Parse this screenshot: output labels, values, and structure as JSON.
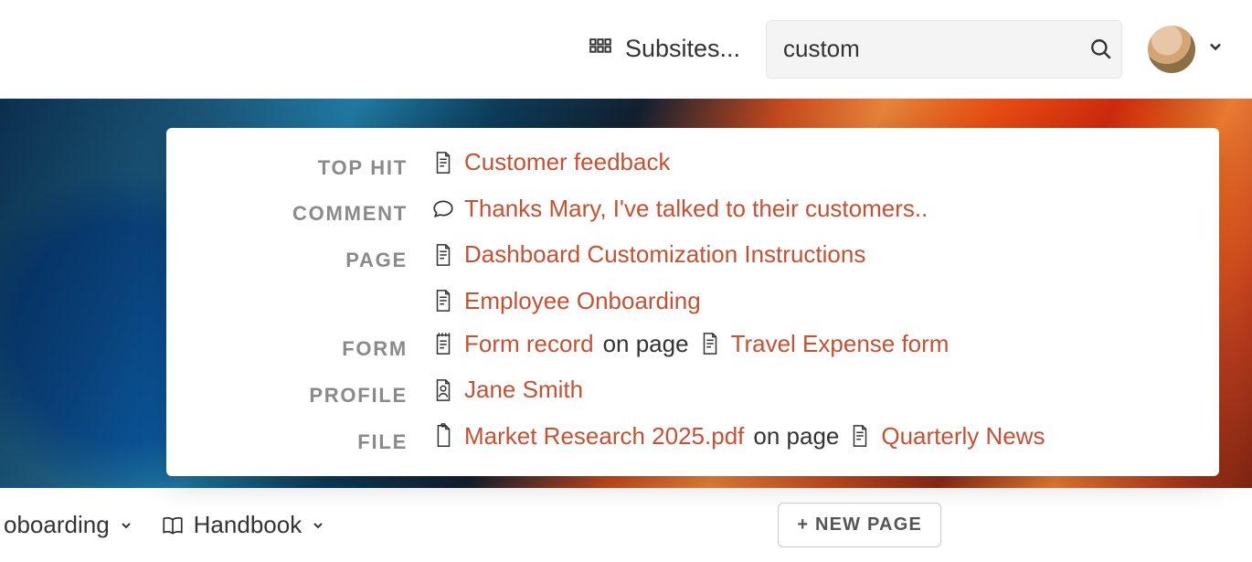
{
  "topbar": {
    "subsites_label": "Subsites...",
    "search_value": "custom",
    "search_placeholder": ""
  },
  "results": {
    "categories": {
      "top_hit": "TOP HIT",
      "comment": "COMMENT",
      "page": "PAGE",
      "form": "FORM",
      "profile": "PROFILE",
      "file": "FILE"
    },
    "top_hit": {
      "title": "Customer feedback"
    },
    "comment": {
      "text": "Thanks Mary, I've talked to their customers.."
    },
    "pages": [
      {
        "title": "Dashboard Customization Instructions"
      },
      {
        "title": "Employee Onboarding"
      }
    ],
    "form": {
      "record": "Form record",
      "on_page": "on page",
      "page_title": "Travel Expense form"
    },
    "profile": {
      "name": "Jane Smith"
    },
    "file": {
      "name": "Market Research 2025.pdf",
      "on_page": "on page",
      "page_title": "Quarterly News"
    }
  },
  "bottombar": {
    "crumb1": "oboarding",
    "crumb2": "Handbook",
    "new_page": "+ NEW PAGE"
  }
}
